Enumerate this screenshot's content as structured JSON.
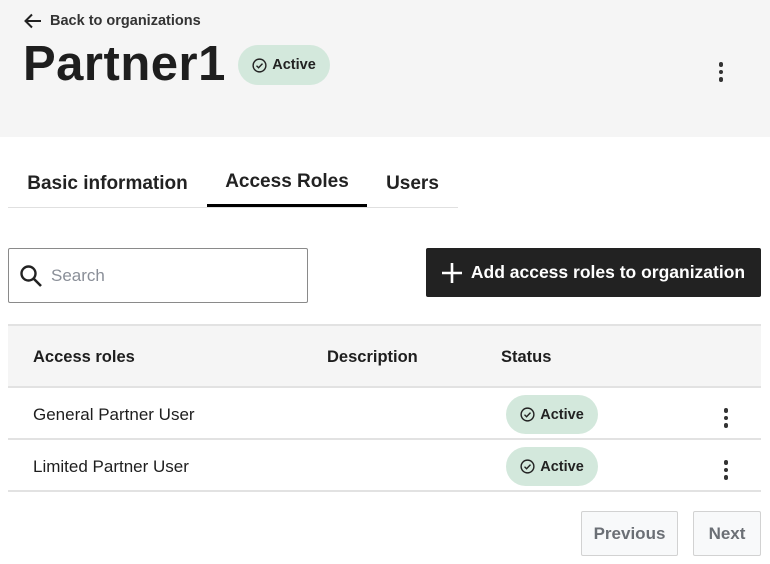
{
  "header": {
    "back_label": "Back to organizations",
    "title": "Partner1",
    "status": "Active"
  },
  "tabs": [
    {
      "label": "Basic information",
      "active": false
    },
    {
      "label": "Access Roles",
      "active": true
    },
    {
      "label": "Users",
      "active": false
    }
  ],
  "search": {
    "placeholder": "Search",
    "value": ""
  },
  "add_button_label": "Add access roles to organization",
  "table": {
    "columns": [
      "Access roles",
      "Description",
      "Status"
    ],
    "rows": [
      {
        "role": "General Partner User",
        "description": "",
        "status": "Active"
      },
      {
        "role": "Limited Partner User",
        "description": "",
        "status": "Active"
      }
    ]
  },
  "pagination": {
    "previous": "Previous",
    "next": "Next"
  }
}
